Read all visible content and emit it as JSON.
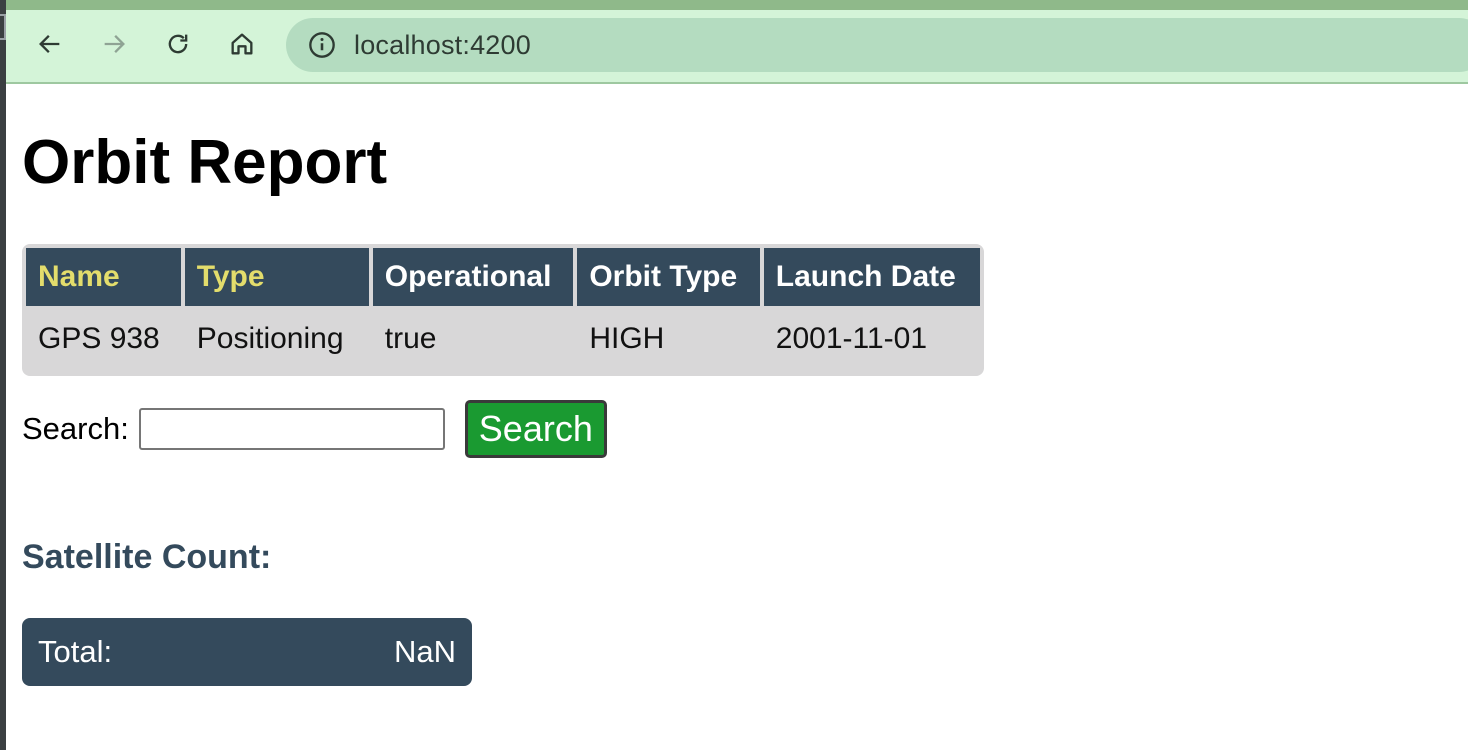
{
  "browser": {
    "url": "localhost:4200",
    "icons": [
      "back-arrow-icon",
      "forward-arrow-icon",
      "reload-icon",
      "home-icon",
      "info-icon"
    ]
  },
  "page": {
    "title": "Orbit Report"
  },
  "table": {
    "headers": [
      "Name",
      "Type",
      "Operational",
      "Orbit Type",
      "Launch Date"
    ],
    "highlighted_headers": [
      "Name",
      "Type"
    ],
    "rows": [
      [
        "GPS 938",
        "Positioning",
        "true",
        "HIGH",
        "2001-11-01"
      ]
    ]
  },
  "search": {
    "label": "Search:",
    "value": "",
    "placeholder": "",
    "button_label": "Search"
  },
  "count": {
    "heading": "Satellite Count:",
    "total_label": "Total:",
    "total_value": "NaN"
  },
  "colors": {
    "header_bg": "#344a5c",
    "header_highlight_text": "#e3dd6c",
    "table_bg": "#d8d7d8",
    "search_button_bg": "#1a9a31",
    "toolbar_bg": "#d4f4d8",
    "address_bar_bg": "#b4dcc0"
  }
}
